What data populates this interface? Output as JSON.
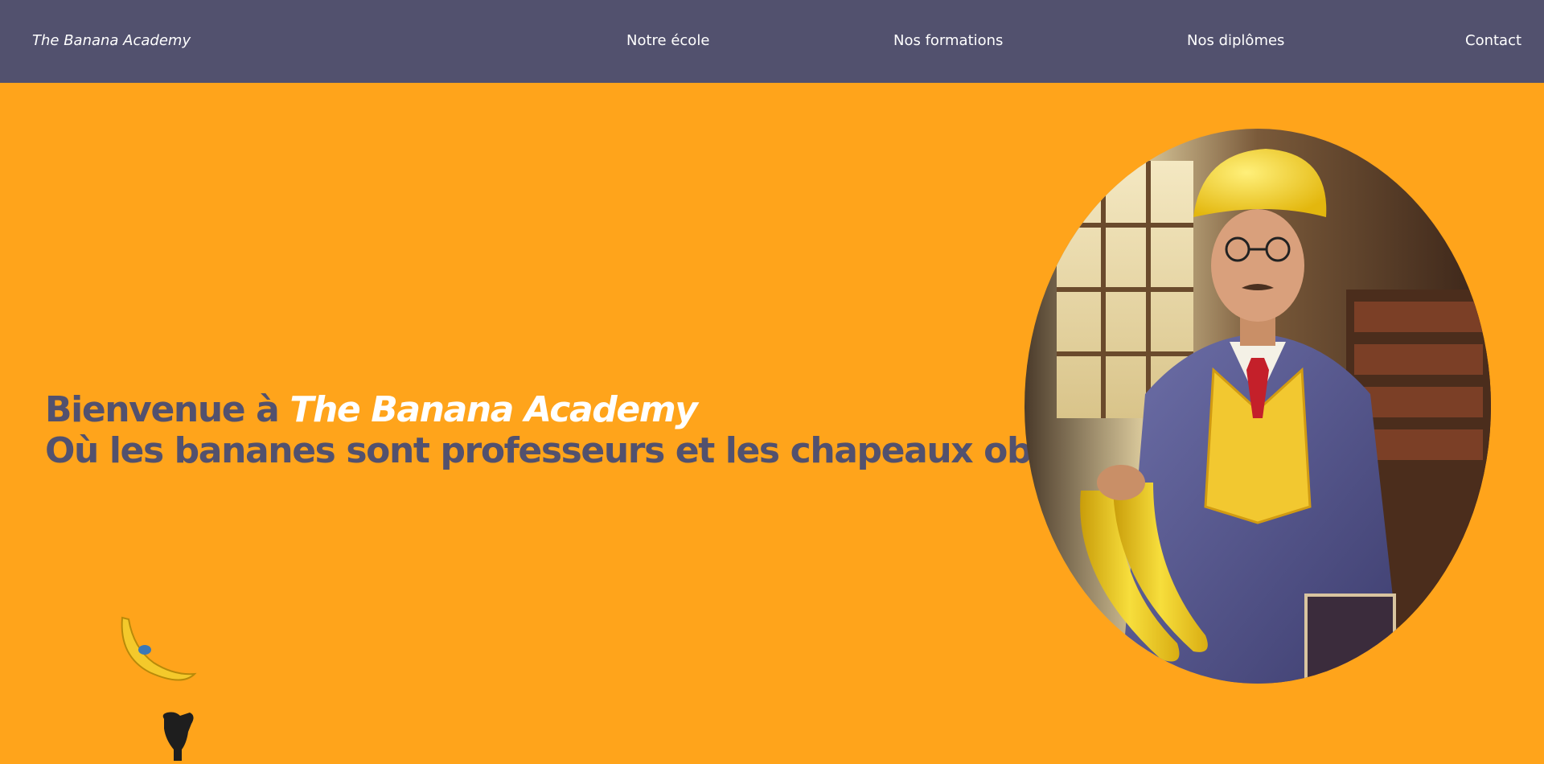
{
  "header": {
    "brand": "The Banana Academy",
    "nav": [
      {
        "label": "Notre école"
      },
      {
        "label": "Nos formations"
      },
      {
        "label": "Nos diplômes"
      },
      {
        "label": "Contact"
      }
    ]
  },
  "hero": {
    "welcome_prefix": "Bienvenue à ",
    "welcome_name": "The Banana Academy",
    "tagline": "Où les bananes sont professeurs et les chapeaux obligatoires"
  },
  "colors": {
    "navbar": "#52516E",
    "background": "#FFA41B",
    "heading": "#52516E",
    "accent_text": "#FFFFFF"
  },
  "icons": {
    "portrait": "banana-professor-portrait",
    "decoration_1": "falling-banana-icon",
    "decoration_2": "black-glove-icon"
  }
}
